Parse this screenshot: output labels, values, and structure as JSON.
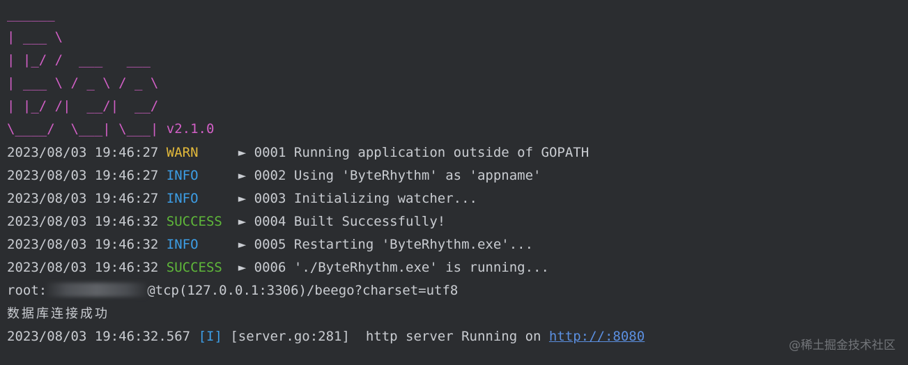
{
  "banner": {
    "lines": [
      "______",
      "| ___ \\",
      "| |_/ /  ___   ___",
      "| ___ \\ / _ \\ / _ \\",
      "| |_/ /|  __/|  __/",
      "\\____/  \\___| \\___|"
    ],
    "version": "v2.1.0"
  },
  "logs": [
    {
      "timestamp": "2023/08/03 19:46:27",
      "level": "WARN",
      "pad": "     ",
      "arrow": "►",
      "seq": "0001",
      "message": "Running application outside of GOPATH"
    },
    {
      "timestamp": "2023/08/03 19:46:27",
      "level": "INFO",
      "pad": "     ",
      "arrow": "►",
      "seq": "0002",
      "message": "Using 'ByteRhythm' as 'appname'"
    },
    {
      "timestamp": "2023/08/03 19:46:27",
      "level": "INFO",
      "pad": "     ",
      "arrow": "►",
      "seq": "0003",
      "message": "Initializing watcher..."
    },
    {
      "timestamp": "2023/08/03 19:46:32",
      "level": "SUCCESS",
      "pad": "  ",
      "arrow": "►",
      "seq": "0004",
      "message": "Built Successfully!"
    },
    {
      "timestamp": "2023/08/03 19:46:32",
      "level": "INFO",
      "pad": "     ",
      "arrow": "►",
      "seq": "0005",
      "message": "Restarting 'ByteRhythm.exe'..."
    },
    {
      "timestamp": "2023/08/03 19:46:32",
      "level": "SUCCESS",
      "pad": "  ",
      "arrow": "►",
      "seq": "0006",
      "message": "'./ByteRhythm.exe' is running..."
    }
  ],
  "dsn": {
    "prefix": "root:",
    "suffix": "@tcp(127.0.0.1:3306)/beego?charset=utf8"
  },
  "db_message": "数据库连接成功",
  "server_log": {
    "timestamp": "2023/08/03 19:46:32.567",
    "tag": "[I]",
    "source": "[server.go:281]",
    "message": "  http server Running on ",
    "link": "http://:8080"
  },
  "watermark": "@稀土掘金技术社区",
  "colors": {
    "background": "#2b2d30",
    "banner": "#d25fc6",
    "warn": "#e2b93b",
    "info": "#3d9ee6",
    "success": "#5fb83a",
    "link": "#5b8fe0"
  }
}
